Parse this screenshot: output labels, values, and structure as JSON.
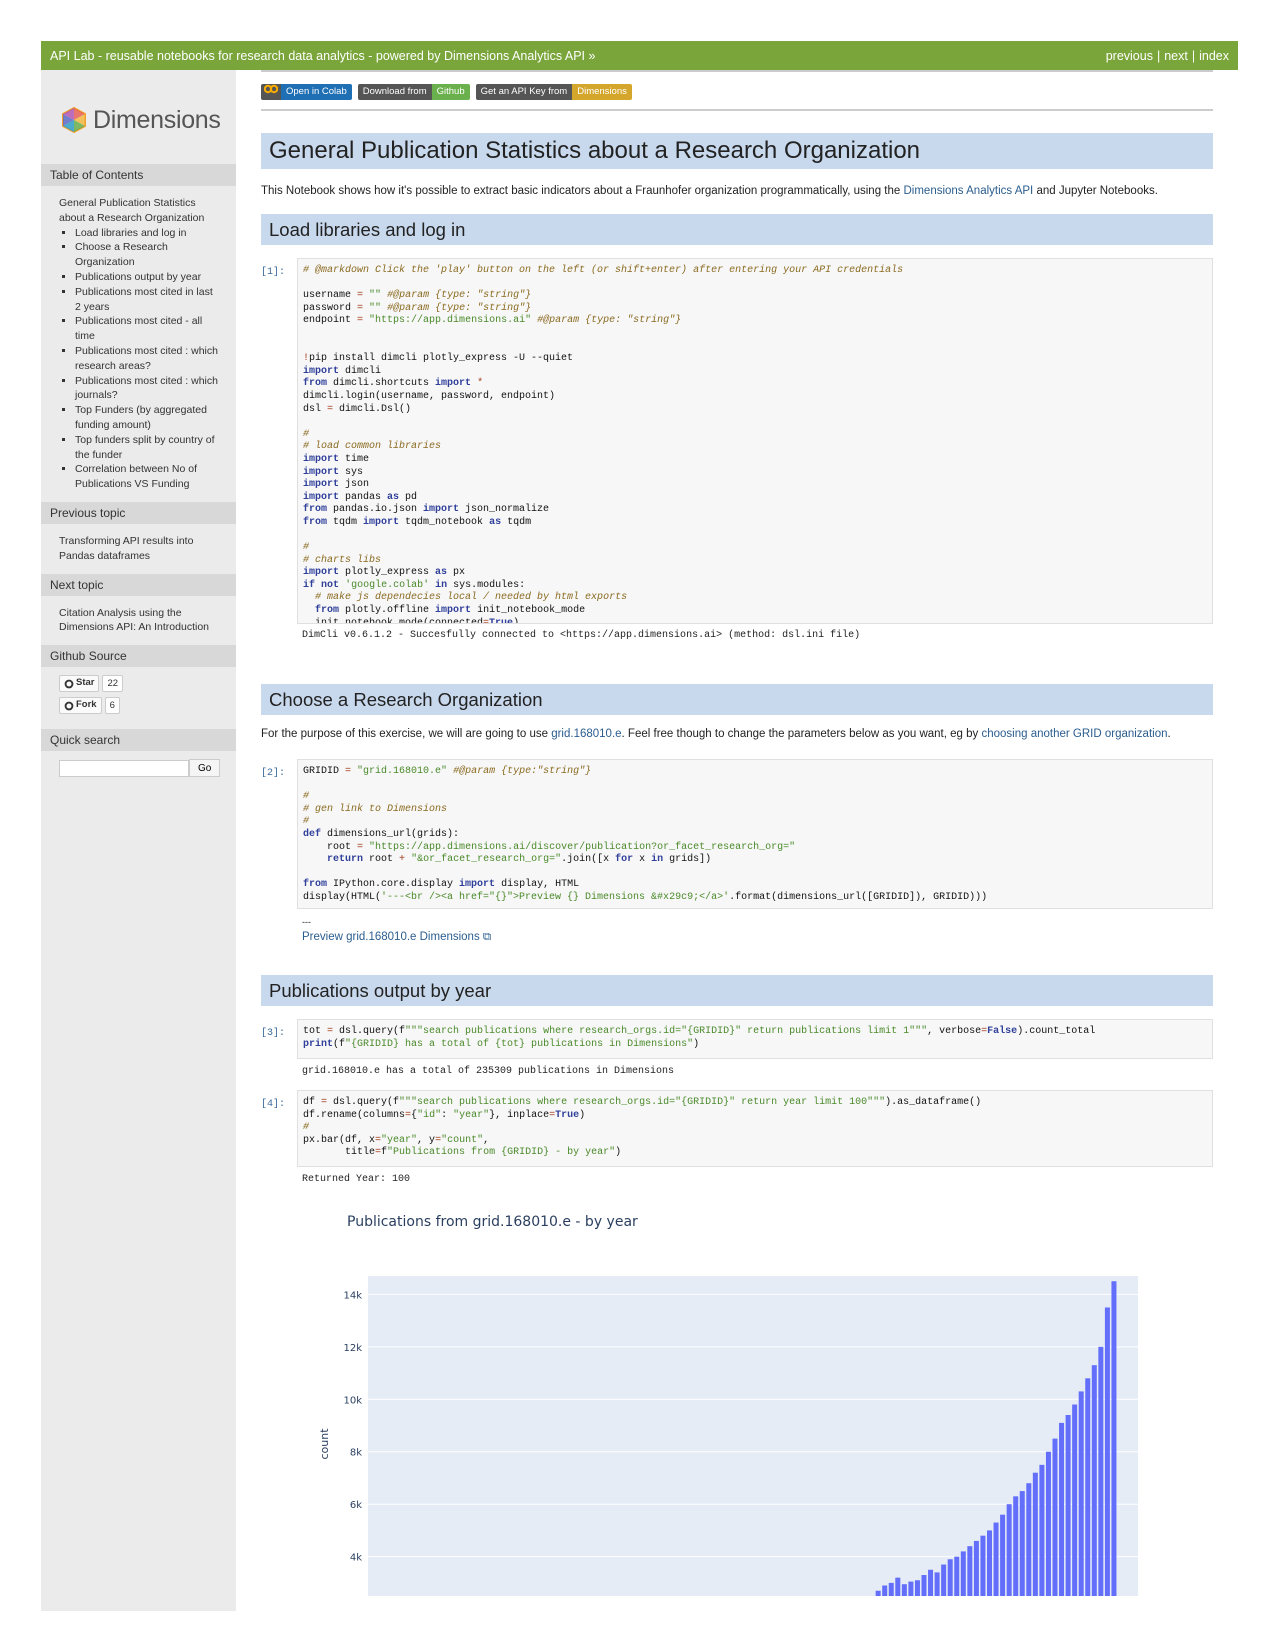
{
  "topbar": {
    "title": "API Lab - reusable notebooks for research data analytics - powered by Dimensions Analytics API »",
    "links": [
      "previous",
      "next",
      "index"
    ],
    "separator": "|"
  },
  "sidebar": {
    "logo_text": "Dimensions",
    "toc_heading": "Table of Contents",
    "toc_root": "General Publication Statistics about a Research Organization",
    "toc_items": [
      "Load libraries and log in",
      "Choose a Research Organization",
      "Publications output by year",
      "Publications most cited in last 2 years",
      "Publications most cited - all time",
      "Publications most cited : which research areas?",
      "Publications most cited : which journals?",
      "Top Funders (by aggregated funding amount)",
      "Top funders split by country of the funder",
      "Correlation between No of Publications VS Funding"
    ],
    "prev_heading": "Previous topic",
    "prev_link": "Transforming API results into Pandas dataframes",
    "next_heading": "Next topic",
    "next_link": "Citation Analysis using the Dimensions API: An Introduction",
    "github_heading": "Github Source",
    "star_label": "Star",
    "star_count": "22",
    "fork_label": "Fork",
    "fork_count": "6",
    "search_heading": "Quick search",
    "search_value": "",
    "search_button": "Go"
  },
  "badges": [
    {
      "left": "Open in Colab",
      "right": "",
      "color": "#1f6fb5"
    },
    {
      "left": "Download from",
      "right": "Github",
      "color": "#6ab04c"
    },
    {
      "left": "Get an API Key from",
      "right": "Dimensions",
      "color": "#d4a72c"
    }
  ],
  "page_title": "General Publication Statistics about a Research Organization",
  "intro": {
    "pre": "This Notebook shows how it's possible to extract basic indicators about a Fraunhofer organization programmatically, using the ",
    "link": "Dimensions Analytics API",
    "post": " and Jupyter Notebooks."
  },
  "sections": {
    "load": "Load libraries and log in",
    "choose": "Choose a Research Organization",
    "pubs": "Publications output by year"
  },
  "choose_text": {
    "pre": "For the purpose of this exercise, we will are going to use ",
    "link1": "grid.168010.e",
    "mid": ". Feel free though to change the parameters below as you want, eg by ",
    "link2": "choosing another GRID organization",
    "post": "."
  },
  "cells": {
    "c1_prompt": "[1]:",
    "c1_out": "DimCli v0.6.1.2 - Succesfully connected to <https://app.dimensions.ai> (method: dsl.ini file)",
    "c2_prompt": "[2]:",
    "c2_out_dash": "---",
    "c2_out_link": "Preview grid.168010.e Dimensions ⧉",
    "c3_prompt": "[3]:",
    "c3_out": "grid.168010.e has a total of 235309 publications in Dimensions",
    "c4_prompt": "[4]:",
    "c4_out": "Returned Year: 100"
  },
  "chart_data": {
    "type": "bar",
    "title": "Publications from grid.168010.e - by year",
    "xlabel": "",
    "ylabel": "count",
    "ylim_visible": [
      2500,
      14700
    ],
    "y_ticks": [
      "14k",
      "12k",
      "10k",
      "8k",
      "6k",
      "4k"
    ],
    "y_tick_values": [
      14000,
      12000,
      10000,
      8000,
      6000,
      4000
    ],
    "bar_color": "#636efa",
    "values": [
      2700,
      2900,
      3000,
      3200,
      2950,
      3050,
      3100,
      3300,
      3500,
      3400,
      3700,
      3900,
      4000,
      4200,
      4400,
      4600,
      4800,
      5000,
      5300,
      5600,
      6000,
      6300,
      6500,
      6800,
      7200,
      7500,
      8000,
      8500,
      9100,
      9400,
      9800,
      10300,
      10800,
      11300,
      12000,
      13500,
      14500
    ]
  }
}
